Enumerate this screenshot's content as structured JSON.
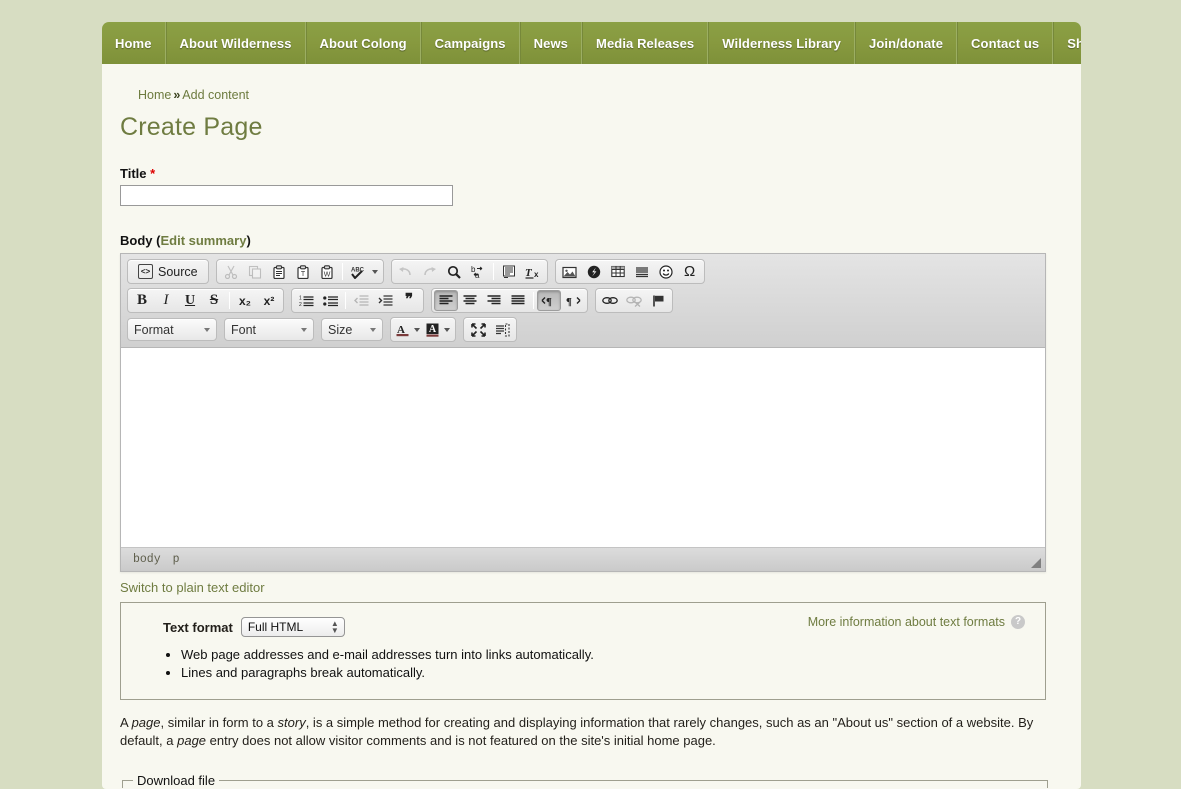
{
  "nav": {
    "items": [
      {
        "label": "Home"
      },
      {
        "label": "About Wilderness"
      },
      {
        "label": "About Colong"
      },
      {
        "label": "Campaigns"
      },
      {
        "label": "News"
      },
      {
        "label": "Media Releases"
      },
      {
        "label": "Wilderness Library"
      },
      {
        "label": "Join/donate"
      },
      {
        "label": "Contact us"
      },
      {
        "label": "Shop"
      }
    ]
  },
  "breadcrumb": {
    "home": "Home",
    "separator": "»",
    "current": "Add content"
  },
  "page": {
    "title": "Create Page"
  },
  "title_field": {
    "label": "Title",
    "required_marker": "*",
    "value": "",
    "placeholder": ""
  },
  "body_field": {
    "label": "Body",
    "edit_summary_open": "(",
    "edit_summary": "Edit summary",
    "edit_summary_close": ")",
    "switch_link": "Switch to plain text editor"
  },
  "editor": {
    "source_button": "Source",
    "source_icon": "source-code-icon",
    "row1": [
      {
        "name": "cut-icon",
        "glyph": "✂",
        "state": "disabled"
      },
      {
        "name": "copy-icon",
        "glyph": "❐",
        "state": "disabled"
      },
      {
        "name": "paste-icon",
        "glyph": "📋",
        "state": "normal"
      },
      {
        "name": "paste-as-plain-text-icon",
        "glyph": "T",
        "state": "normal"
      },
      {
        "name": "paste-from-word-icon",
        "glyph": "W",
        "state": "normal"
      },
      {
        "name": "spell-check-icon",
        "glyph": "ABC",
        "state": "normal"
      },
      {
        "name": "undo-icon",
        "glyph": "↶",
        "state": "disabled"
      },
      {
        "name": "redo-icon",
        "glyph": "↷",
        "state": "disabled"
      },
      {
        "name": "find-icon",
        "glyph": "🔍",
        "state": "normal"
      },
      {
        "name": "replace-icon",
        "glyph": "b→a",
        "state": "normal"
      },
      {
        "name": "select-all-icon",
        "glyph": "▤",
        "state": "normal"
      },
      {
        "name": "remove-format-icon",
        "glyph": "Tx",
        "state": "normal"
      },
      {
        "name": "image-icon",
        "glyph": "🖼",
        "state": "normal"
      },
      {
        "name": "flash-icon",
        "glyph": "◕",
        "state": "normal"
      },
      {
        "name": "table-icon",
        "glyph": "▦",
        "state": "normal"
      },
      {
        "name": "horizontal-rule-icon",
        "glyph": "☰",
        "state": "normal"
      },
      {
        "name": "smiley-icon",
        "glyph": "☺",
        "state": "normal"
      },
      {
        "name": "special-character-icon",
        "glyph": "Ω",
        "state": "normal"
      }
    ],
    "row2": [
      {
        "name": "bold-icon",
        "glyph": "B",
        "state": "normal"
      },
      {
        "name": "italic-icon",
        "glyph": "I",
        "state": "normal"
      },
      {
        "name": "underline-icon",
        "glyph": "U",
        "state": "normal"
      },
      {
        "name": "strikethrough-icon",
        "glyph": "S",
        "state": "normal"
      },
      {
        "name": "subscript-icon",
        "glyph": "x₂",
        "state": "normal"
      },
      {
        "name": "superscript-icon",
        "glyph": "x²",
        "state": "normal"
      },
      {
        "name": "numbered-list-icon",
        "glyph": "1≡",
        "state": "normal"
      },
      {
        "name": "bulleted-list-icon",
        "glyph": "•≡",
        "state": "normal"
      },
      {
        "name": "decrease-indent-icon",
        "glyph": "◂≡",
        "state": "disabled"
      },
      {
        "name": "increase-indent-icon",
        "glyph": "▸≡",
        "state": "normal"
      },
      {
        "name": "blockquote-icon",
        "glyph": "❞",
        "state": "normal"
      },
      {
        "name": "align-left-icon",
        "glyph": "≡",
        "state": "active"
      },
      {
        "name": "align-center-icon",
        "glyph": "≡",
        "state": "normal"
      },
      {
        "name": "align-right-icon",
        "glyph": "≡",
        "state": "normal"
      },
      {
        "name": "align-justify-icon",
        "glyph": "≡",
        "state": "normal"
      },
      {
        "name": "text-direction-ltr-icon",
        "glyph": "¶",
        "state": "active"
      },
      {
        "name": "text-direction-rtl-icon",
        "glyph": "¶",
        "state": "normal"
      },
      {
        "name": "link-icon",
        "glyph": "🔗",
        "state": "normal"
      },
      {
        "name": "unlink-icon",
        "glyph": "🔗",
        "state": "disabled"
      },
      {
        "name": "anchor-icon",
        "glyph": "⚑",
        "state": "normal"
      }
    ],
    "combos": {
      "format": "Format",
      "font": "Font",
      "size": "Size"
    },
    "color_buttons": [
      {
        "name": "text-color-icon",
        "glyph": "A"
      },
      {
        "name": "background-color-icon",
        "glyph": "A"
      }
    ],
    "tool_buttons": [
      {
        "name": "maximize-icon",
        "glyph": "⤢"
      },
      {
        "name": "show-blocks-icon",
        "glyph": "▤"
      }
    ],
    "content": "",
    "path": [
      "body",
      "p"
    ]
  },
  "text_format": {
    "more_info_link": "More information about text formats",
    "help_icon_glyph": "?",
    "label": "Text format",
    "selected": "Full HTML",
    "options": [
      "Full HTML"
    ],
    "tips": [
      "Web page addresses and e-mail addresses turn into links automatically.",
      "Lines and paragraphs break automatically."
    ]
  },
  "node_description": {
    "line1_a": "A ",
    "line1_em1": "page",
    "line1_b": ", similar in form to a ",
    "line1_em2": "story",
    "line1_c": ", is a simple method for creating and displaying information that rarely changes, such as an \"About us\" section of a website.",
    "line2_a": "By default, a ",
    "line2_em": "page",
    "line2_b": " entry does not allow visitor comments and is not featured on the site's initial home page."
  },
  "download_fieldset": {
    "legend": "Download file"
  },
  "colors": {
    "page_background": "#d7ddc2",
    "nav_green": "#87993f",
    "content_background": "#f8f8f0",
    "heading_green": "#6f7c41",
    "link_green": "#6d7b3f",
    "required_red": "#d00000"
  }
}
